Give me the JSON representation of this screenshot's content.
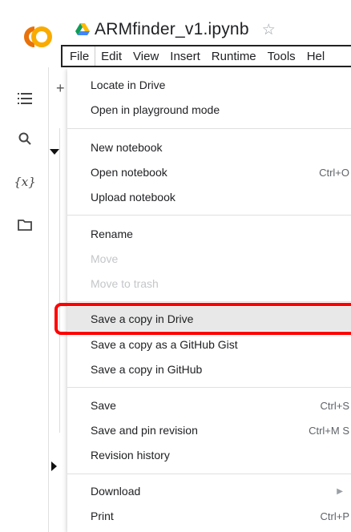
{
  "app": {
    "title": "ARMfinder_v1.ipynb",
    "star": "☆",
    "logo_text": "CO"
  },
  "menubar": {
    "items": [
      "File",
      "Edit",
      "View",
      "Insert",
      "Runtime",
      "Tools",
      "Hel"
    ],
    "active": "File"
  },
  "sidebar": {
    "icons": [
      "table-of-contents-icon",
      "search-icon",
      "variables-icon",
      "folder-icon"
    ],
    "variables_label": "{x}"
  },
  "file_menu": {
    "groups": [
      [
        {
          "label": "Locate in Drive",
          "shortcut": "",
          "disabled": false
        },
        {
          "label": "Open in playground mode",
          "shortcut": "",
          "disabled": false
        }
      ],
      [
        {
          "label": "New notebook",
          "shortcut": "",
          "disabled": false
        },
        {
          "label": "Open notebook",
          "shortcut": "Ctrl+O",
          "disabled": false
        },
        {
          "label": "Upload notebook",
          "shortcut": "",
          "disabled": false
        }
      ],
      [
        {
          "label": "Rename",
          "shortcut": "",
          "disabled": false
        },
        {
          "label": "Move",
          "shortcut": "",
          "disabled": true
        },
        {
          "label": "Move to trash",
          "shortcut": "",
          "disabled": true
        }
      ],
      [
        {
          "label": "Save a copy in Drive",
          "shortcut": "",
          "disabled": false,
          "highlighted": true
        },
        {
          "label": "Save a copy as a GitHub Gist",
          "shortcut": "",
          "disabled": false
        },
        {
          "label": "Save a copy in GitHub",
          "shortcut": "",
          "disabled": false
        }
      ],
      [
        {
          "label": "Save",
          "shortcut": "Ctrl+S",
          "disabled": false
        },
        {
          "label": "Save and pin revision",
          "shortcut": "Ctrl+M S",
          "disabled": false
        },
        {
          "label": "Revision history",
          "shortcut": "",
          "disabled": false
        }
      ],
      [
        {
          "label": "Download",
          "shortcut": "",
          "disabled": false,
          "submenu": true
        },
        {
          "label": "Print",
          "shortcut": "Ctrl+P",
          "disabled": false
        }
      ]
    ]
  },
  "colors": {
    "logo_orange": "#F9AB00",
    "logo_dark_orange": "#E8710A",
    "highlight_box": "#FF0000",
    "disabled_text": "#C4C6C9"
  }
}
